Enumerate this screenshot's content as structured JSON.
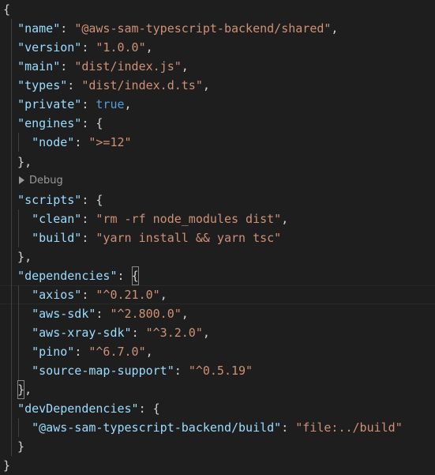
{
  "editor": {
    "lines": [
      {
        "tokens": [
          {
            "t": "{",
            "c": "p"
          }
        ]
      },
      {
        "tokens": [
          {
            "t": "  ",
            "c": "p"
          },
          {
            "t": "\"name\"",
            "c": "k"
          },
          {
            "t": ": ",
            "c": "p"
          },
          {
            "t": "\"@aws-sam-typescript-backend/shared\"",
            "c": "s"
          },
          {
            "t": ",",
            "c": "p"
          }
        ]
      },
      {
        "tokens": [
          {
            "t": "  ",
            "c": "p"
          },
          {
            "t": "\"version\"",
            "c": "k"
          },
          {
            "t": ": ",
            "c": "p"
          },
          {
            "t": "\"1.0.0\"",
            "c": "s"
          },
          {
            "t": ",",
            "c": "p"
          }
        ]
      },
      {
        "tokens": [
          {
            "t": "  ",
            "c": "p"
          },
          {
            "t": "\"main\"",
            "c": "k"
          },
          {
            "t": ": ",
            "c": "p"
          },
          {
            "t": "\"dist/index.js\"",
            "c": "s"
          },
          {
            "t": ",",
            "c": "p"
          }
        ]
      },
      {
        "tokens": [
          {
            "t": "  ",
            "c": "p"
          },
          {
            "t": "\"types\"",
            "c": "k"
          },
          {
            "t": ": ",
            "c": "p"
          },
          {
            "t": "\"dist/index.d.ts\"",
            "c": "s"
          },
          {
            "t": ",",
            "c": "p"
          }
        ]
      },
      {
        "tokens": [
          {
            "t": "  ",
            "c": "p"
          },
          {
            "t": "\"private\"",
            "c": "k"
          },
          {
            "t": ": ",
            "c": "p"
          },
          {
            "t": "true",
            "c": "b"
          },
          {
            "t": ",",
            "c": "p"
          }
        ]
      },
      {
        "tokens": [
          {
            "t": "  ",
            "c": "p"
          },
          {
            "t": "\"engines\"",
            "c": "k"
          },
          {
            "t": ": {",
            "c": "p"
          }
        ]
      },
      {
        "tokens": [
          {
            "t": "    ",
            "c": "p"
          },
          {
            "t": "\"node\"",
            "c": "k"
          },
          {
            "t": ": ",
            "c": "p"
          },
          {
            "t": "\">=12\"",
            "c": "s"
          }
        ]
      },
      {
        "tokens": [
          {
            "t": "  },",
            "c": "p"
          }
        ]
      },
      {
        "tokens": [
          {
            "t": "  ",
            "c": "p"
          },
          {
            "t": "\"scripts\"",
            "c": "k"
          },
          {
            "t": ": {",
            "c": "p"
          }
        ]
      },
      {
        "tokens": [
          {
            "t": "    ",
            "c": "p"
          },
          {
            "t": "\"clean\"",
            "c": "k"
          },
          {
            "t": ": ",
            "c": "p"
          },
          {
            "t": "\"rm -rf node_modules dist\"",
            "c": "s"
          },
          {
            "t": ",",
            "c": "p"
          }
        ]
      },
      {
        "tokens": [
          {
            "t": "    ",
            "c": "p"
          },
          {
            "t": "\"build\"",
            "c": "k"
          },
          {
            "t": ": ",
            "c": "p"
          },
          {
            "t": "\"yarn install && yarn tsc\"",
            "c": "s"
          }
        ]
      },
      {
        "tokens": [
          {
            "t": "  },",
            "c": "p"
          }
        ]
      },
      {
        "tokens": [
          {
            "t": "  ",
            "c": "p"
          },
          {
            "t": "\"dependencies\"",
            "c": "k"
          },
          {
            "t": ": ",
            "c": "p"
          },
          {
            "t": "{",
            "c": "p",
            "bm": true
          }
        ]
      },
      {
        "tokens": [
          {
            "t": "    ",
            "c": "p"
          },
          {
            "t": "\"axios\"",
            "c": "k"
          },
          {
            "t": ": ",
            "c": "p"
          },
          {
            "t": "\"^0.21.0\"",
            "c": "s"
          },
          {
            "t": ",",
            "c": "p"
          }
        ],
        "current": true
      },
      {
        "tokens": [
          {
            "t": "    ",
            "c": "p"
          },
          {
            "t": "\"aws-sdk\"",
            "c": "k"
          },
          {
            "t": ": ",
            "c": "p"
          },
          {
            "t": "\"^2.800.0\"",
            "c": "s"
          },
          {
            "t": ",",
            "c": "p"
          }
        ]
      },
      {
        "tokens": [
          {
            "t": "    ",
            "c": "p"
          },
          {
            "t": "\"aws-xray-sdk\"",
            "c": "k"
          },
          {
            "t": ": ",
            "c": "p"
          },
          {
            "t": "\"^3.2.0\"",
            "c": "s"
          },
          {
            "t": ",",
            "c": "p"
          }
        ]
      },
      {
        "tokens": [
          {
            "t": "    ",
            "c": "p"
          },
          {
            "t": "\"pino\"",
            "c": "k"
          },
          {
            "t": ": ",
            "c": "p"
          },
          {
            "t": "\"^6.7.0\"",
            "c": "s"
          },
          {
            "t": ",",
            "c": "p"
          }
        ]
      },
      {
        "tokens": [
          {
            "t": "    ",
            "c": "p"
          },
          {
            "t": "\"source-map-support\"",
            "c": "k"
          },
          {
            "t": ": ",
            "c": "p"
          },
          {
            "t": "\"^0.5.19\"",
            "c": "s"
          }
        ]
      },
      {
        "tokens": [
          {
            "t": "  ",
            "c": "p"
          },
          {
            "t": "}",
            "c": "p",
            "bm": true
          },
          {
            "t": ",",
            "c": "p"
          }
        ]
      },
      {
        "tokens": [
          {
            "t": "  ",
            "c": "p"
          },
          {
            "t": "\"devDependencies\"",
            "c": "k"
          },
          {
            "t": ": {",
            "c": "p"
          }
        ]
      },
      {
        "tokens": [
          {
            "t": "    ",
            "c": "p"
          },
          {
            "t": "\"@aws-sam-typescript-backend/build\"",
            "c": "k"
          },
          {
            "t": ": ",
            "c": "p"
          },
          {
            "t": "\"file:../build\"",
            "c": "s"
          }
        ]
      },
      {
        "tokens": [
          {
            "t": "  }",
            "c": "p"
          }
        ]
      },
      {
        "tokens": [
          {
            "t": "}",
            "c": "p"
          }
        ]
      }
    ],
    "codelens": {
      "label": "Debug",
      "icon": "play-triangle-icon"
    },
    "colors": {
      "background": "#1e1e1e",
      "property_key": "#9cdcfe",
      "string_value": "#ce9178",
      "boolean": "#569cd6",
      "punctuation": "#d4d4d4",
      "codelens": "#999999",
      "indent_guide": "#404040"
    }
  }
}
